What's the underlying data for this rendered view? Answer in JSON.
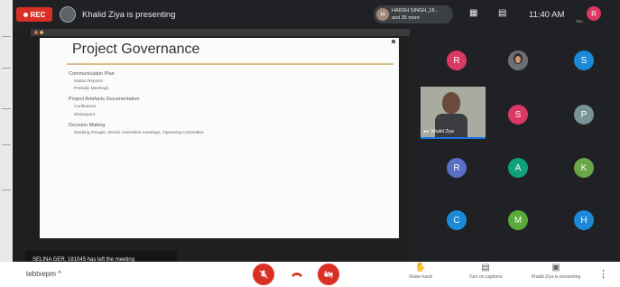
{
  "topbar": {
    "rec_label": "REC",
    "presenting_text": "Khalid Ziya is presenting",
    "participants_chip": {
      "avatar_initial": "H",
      "line1": "HARSH SINGH_18...",
      "line2": "and 35 more"
    },
    "time": "11:40 AM",
    "you_avatar_initial": "R",
    "you_label": "You"
  },
  "slide": {
    "title": "Project Governance",
    "sections": [
      {
        "heading": "Communication Plan",
        "items": [
          "Status Reports",
          "Periodic Meetings"
        ]
      },
      {
        "heading": "Project Artefacts Documentation",
        "items": [
          "Confluence",
          "Sharepoint"
        ]
      },
      {
        "heading": "Decision Making",
        "items": [
          "Working Groups, Senior committee meetings, Operating Committee"
        ]
      }
    ]
  },
  "notification": "SELINA GER, 181045 has left the meeting",
  "participants": [
    {
      "initial": "R",
      "color": "#d93964"
    },
    {
      "initial": "",
      "color": "#8a6a5a",
      "photo": true
    },
    {
      "initial": "S",
      "color": "#1a8ad8"
    },
    {
      "initial": "S",
      "color": "#d93964"
    },
    {
      "initial": "P",
      "color": "#789296"
    },
    {
      "initial": "R",
      "color": "#5b6fc7"
    },
    {
      "initial": "A",
      "color": "#10a07a"
    },
    {
      "initial": "K",
      "color": "#6aa74a"
    },
    {
      "initial": "C",
      "color": "#1a8ad8"
    },
    {
      "initial": "M",
      "color": "#5aaa3c"
    },
    {
      "initial": "H",
      "color": "#1a8ad8"
    }
  ],
  "speaker": {
    "name": "Khalid Ziya"
  },
  "bottombar": {
    "meeting_code": "tebtxepm",
    "raise_hand": "Raise hand",
    "captions": "Turn on captions",
    "presenting": "Khalid Ziya is presenting"
  },
  "colors": {
    "rec": "#d93025",
    "end_call": "#d93025",
    "speaker_highlight": "#1a73e8",
    "slide_rule": "#d6c08a"
  }
}
